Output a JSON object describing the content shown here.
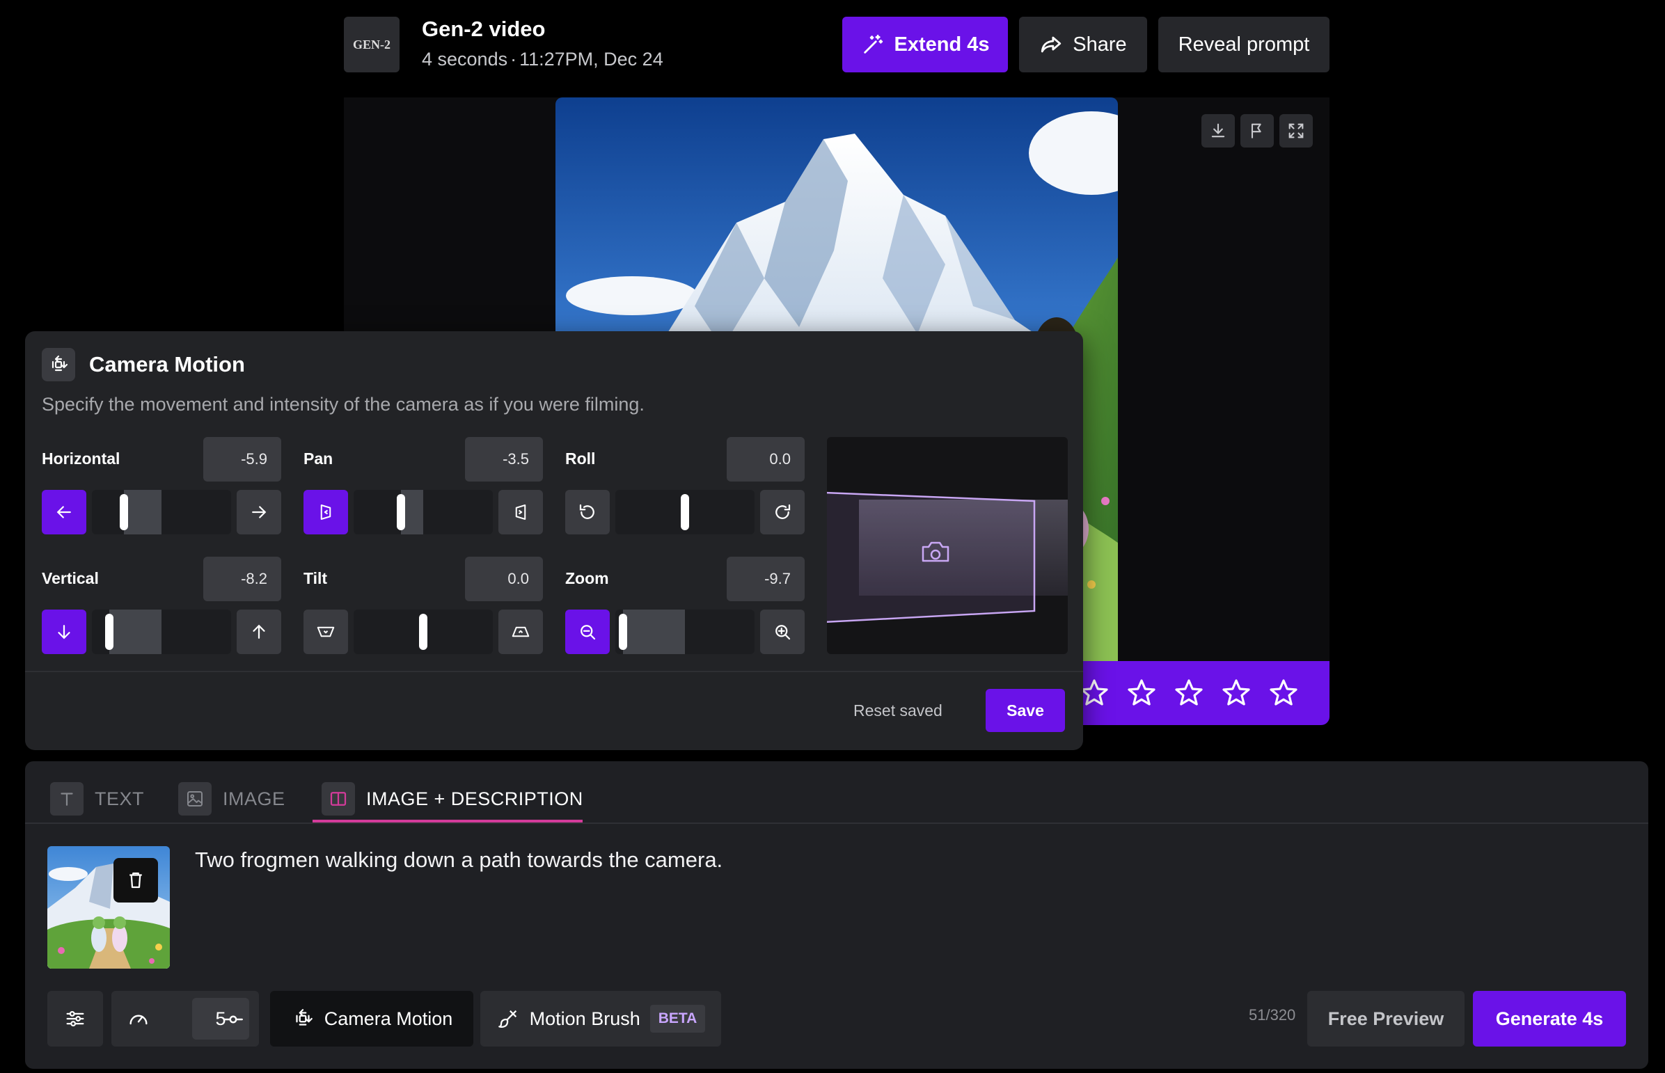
{
  "header": {
    "logo_text": "GEN-2",
    "title": "Gen-2 video",
    "duration": "4 seconds",
    "separator": "·",
    "timestamp": "11:27PM, Dec 24",
    "extend_label": "Extend 4s",
    "share_label": "Share",
    "reveal_label": "Reveal prompt"
  },
  "video_tools": {
    "download_icon": "download-icon",
    "flag_icon": "flag-icon",
    "fullscreen_icon": "fullscreen-icon"
  },
  "rating": {
    "stars_total": 5,
    "stars_filled": 0
  },
  "camera_motion": {
    "title": "Camera Motion",
    "description": "Specify the movement and intensity of the camera as if you were filming.",
    "controls": [
      {
        "key": "horizontal",
        "label": "Horizontal",
        "value": "-5.9",
        "numeric": -5.9
      },
      {
        "key": "pan",
        "label": "Pan",
        "value": "-3.5",
        "numeric": -3.5
      },
      {
        "key": "roll",
        "label": "Roll",
        "value": "0.0",
        "numeric": 0.0
      },
      {
        "key": "vertical",
        "label": "Vertical",
        "value": "-8.2",
        "numeric": -8.2
      },
      {
        "key": "tilt",
        "label": "Tilt",
        "value": "0.0",
        "numeric": 0.0
      },
      {
        "key": "zoom",
        "label": "Zoom",
        "value": "-9.7",
        "numeric": -9.7
      }
    ],
    "range": [
      -10,
      10
    ],
    "reset_label": "Reset saved",
    "save_label": "Save"
  },
  "prompt_panel": {
    "tabs": [
      {
        "label": "TEXT",
        "icon": "text-icon",
        "active": false
      },
      {
        "label": "IMAGE",
        "icon": "image-icon",
        "active": false
      },
      {
        "label": "IMAGE + DESCRIPTION",
        "icon": "image-description-icon",
        "active": true
      }
    ],
    "prompt_text": "Two frogmen walking down a path towards the camera.",
    "speed_value": "5",
    "camera_motion_label": "Camera Motion",
    "motion_brush_label": "Motion Brush",
    "beta_label": "BETA",
    "char_count": "51/320",
    "free_preview_label": "Free Preview",
    "generate_label": "Generate 4s"
  },
  "colors": {
    "accent": "#6a12e8",
    "tab_underline": "#d33b9a",
    "panel_bg": "#222326",
    "background": "#000000"
  }
}
